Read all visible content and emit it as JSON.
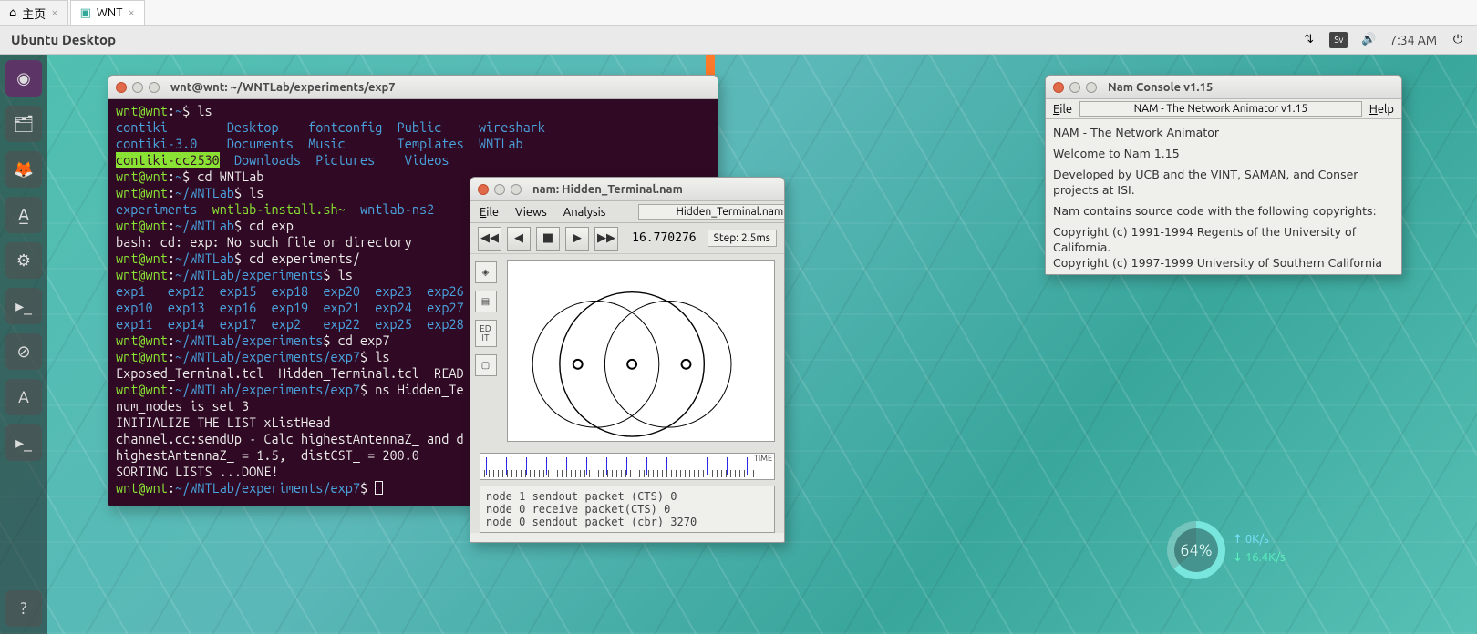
{
  "tabs": {
    "home": "主页",
    "wnt": "WNT"
  },
  "menubar": {
    "title": "Ubuntu Desktop",
    "lang": "Sv",
    "time": "7:34 AM"
  },
  "terminal": {
    "title": "wnt@wnt: ~/WNTLab/experiments/exp7",
    "userhost": "wnt@wnt",
    "p_home": "~",
    "p_wnt": "~/WNTLab",
    "p_exp": "~/WNTLab/experiments",
    "p_e7": "~/WNTLab/experiments/exp7",
    "cmd_ls": "ls",
    "cmd_cdw": "cd WNTLab",
    "cmd_cde": "cd exp",
    "cmd_cdex": "cd experiments/",
    "cmd_cde7": "cd exp7",
    "cmd_ns": "ns Hidden_Te",
    "err_noexp": "bash: cd: exp: No such file or directory",
    "ls_home_r1": [
      "contiki",
      "Desktop",
      "fontconfig",
      "Public",
      "wireshark"
    ],
    "ls_home_r2": [
      "contiki-3.0",
      "Documents",
      "Music",
      "Templates",
      "WNTLab"
    ],
    "ls_home_r3_hl": "contiki-cc2530",
    "ls_home_r3": [
      "Downloads",
      "Pictures",
      "Videos"
    ],
    "ls_wnt_dir": "experiments",
    "ls_wnt_exe": "wntlab-install.sh~",
    "ls_wnt_file": "wntlab-ns2",
    "exps_r1": [
      "exp1",
      "exp12",
      "exp15",
      "exp18",
      "exp20",
      "exp23",
      "exp26"
    ],
    "exps_r2": [
      "exp10",
      "exp13",
      "exp16",
      "exp19",
      "exp21",
      "exp24",
      "exp27"
    ],
    "exps_r3": [
      "exp11",
      "exp14",
      "exp17",
      "exp2",
      "exp22",
      "exp25",
      "exp28"
    ],
    "ls_e7": "Exposed_Terminal.tcl  Hidden_Terminal.tcl  READ",
    "out1": "num_nodes is set 3",
    "out2": "INITIALIZE THE LIST xListHead",
    "out3": "channel.cc:sendUp - Calc highestAntennaZ_ and d",
    "out4": "highestAntennaZ_ = 1.5,  distCST_ = 200.0",
    "out5": "SORTING LISTS ...DONE!"
  },
  "nam": {
    "title": "nam: Hidden_Terminal.nam",
    "menu_file": "Eile",
    "menu_views": "Views",
    "menu_analysis": "Analysis",
    "filename": "Hidden_Terminal.nam",
    "time": "16.770276",
    "step": "Step: 2.5ms",
    "timeline_label": "TIME",
    "sidebar_edit": "ED\nIT",
    "log1": "node 1 sendout packet (CTS) 0",
    "log2": "node 0 receive packet(CTS) 0",
    "log3": "node 0 sendout packet (cbr) 3270"
  },
  "console": {
    "title": "Nam Console v1.15",
    "menu_file": "Eile",
    "menu_help": "Help",
    "field": "NAM - The Network Animator v1.15",
    "l1": "NAM - The Network Animator",
    "l2": "Welcome to Nam 1.15",
    "l3": "Developed by UCB and the VINT, SAMAN, and Conser projects at ISI.",
    "l4": "Nam contains source code with the following copyrights:",
    "l5": "Copyright (c) 1991-1994 Regents of the University of California.",
    "l6": "Copyright (c) 1997-1999 University of Southern California"
  },
  "hud": {
    "pct": "64%",
    "up": "0K/s",
    "down": "16.4K/s"
  }
}
